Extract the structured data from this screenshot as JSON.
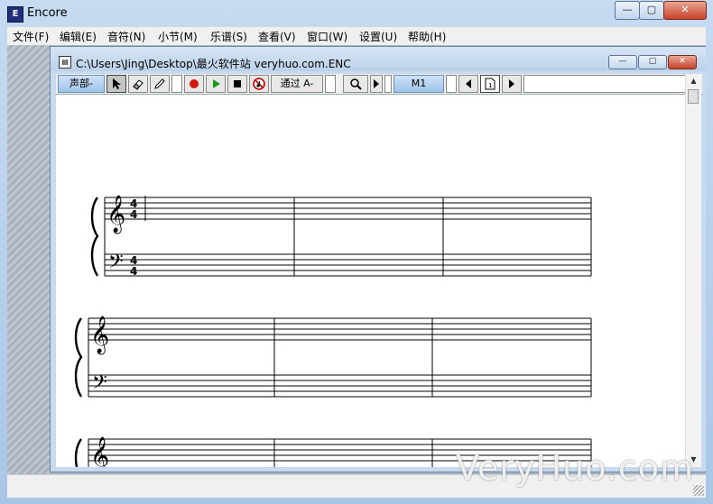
{
  "app": {
    "title": "Encore",
    "icon_letter": "E"
  },
  "window_controls": {
    "minimize": "—",
    "maximize": "▢",
    "close": "✕"
  },
  "menu": [
    "文件(F)",
    "编辑(E)",
    "音符(N)",
    "小节(M)",
    "乐谱(S)",
    "查看(V)",
    "窗口(W)",
    "设置(U)",
    "帮助(H)"
  ],
  "document": {
    "title": "C:\\Users\\Jing\\Desktop\\最火软件站 veryhuo.com.ENC"
  },
  "toolbar": {
    "voice_label": "声部-",
    "tools": [
      "select-tool",
      "eraser-tool",
      "pencil-tool"
    ],
    "playback": {
      "record": "record",
      "play": "play",
      "stop": "stop",
      "mute": "mute"
    },
    "channel_label": "通过 A-",
    "measure_label": "M1"
  },
  "score": {
    "time_signature": {
      "top": "4",
      "bottom": "4"
    },
    "colors": {
      "staff": "#000000",
      "background": "#ffffff"
    }
  },
  "watermark": "VeryHuo.com"
}
